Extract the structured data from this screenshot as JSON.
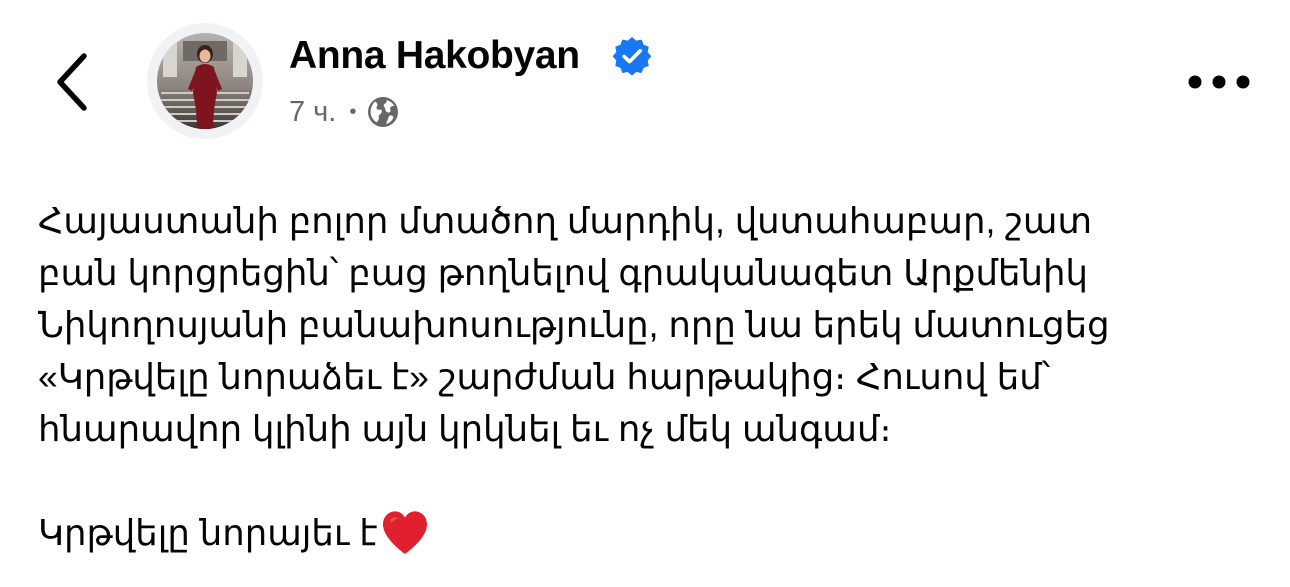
{
  "header": {
    "back_icon": "chevron-left-icon",
    "author_name": "Anna Hakobyan",
    "verified_icon": "verified-badge-icon",
    "timestamp": "7 ч.",
    "separator": "•",
    "audience_icon": "globe-icon",
    "more_icon": "more-horizontal-icon"
  },
  "post": {
    "lines": [
      "Հայաստանի բոլոր մտածող մարդիկ, վստահաբար, շատ",
      "բան կորցրեցին՝ բաց թողնելով գրականագետ Արքմենիկ",
      "Նիկողոսյանի բանախոսությունը, որը նա երեկ մատուցեց",
      "«Կրթվելը նորաձեւ է» շարժման հարթակից։ Հուսով եմ՝",
      "հնարավոր կլինի այն կրկնել եւ ոչ մեկ անգամ։"
    ],
    "closing": "Կրթվելը նորայեւ է",
    "closing_emoji": "heart-icon"
  },
  "colors": {
    "text": "#050505",
    "secondary_text": "#65676b",
    "verified": "#1877f2",
    "heart": "#e0202e",
    "avatar_ring": "#f0f2f5"
  }
}
